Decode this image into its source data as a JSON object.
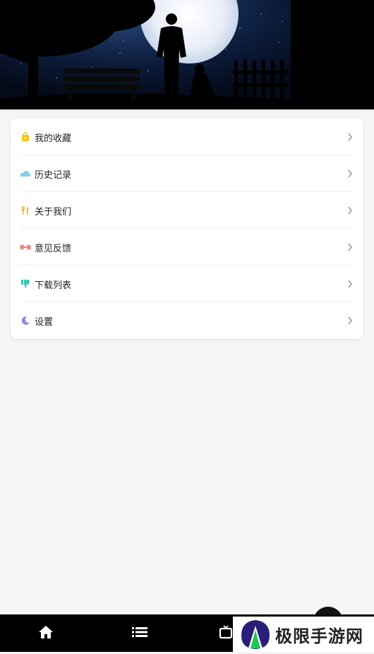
{
  "menu": {
    "items": [
      {
        "label": "我的收藏",
        "icon": "lock-bag-icon",
        "color": "#f5c518"
      },
      {
        "label": "历史记录",
        "icon": "cloud-icon",
        "color": "#7fd0e8"
      },
      {
        "label": "关于我们",
        "icon": "fork-knife-icon",
        "color": "#f0b429"
      },
      {
        "label": "意见反馈",
        "icon": "dumbbell-icon",
        "color": "#f08080"
      },
      {
        "label": "下载列表",
        "icon": "thumbs-down-icon",
        "color": "#3cc8b4"
      },
      {
        "label": "设置",
        "icon": "moon-icon",
        "color": "#8b8be8"
      }
    ]
  },
  "tabbar": {
    "tabs": [
      {
        "icon": "home-icon"
      },
      {
        "icon": "list-icon"
      },
      {
        "icon": "tv-icon"
      }
    ]
  },
  "watermark": {
    "text": "极限手游网"
  }
}
